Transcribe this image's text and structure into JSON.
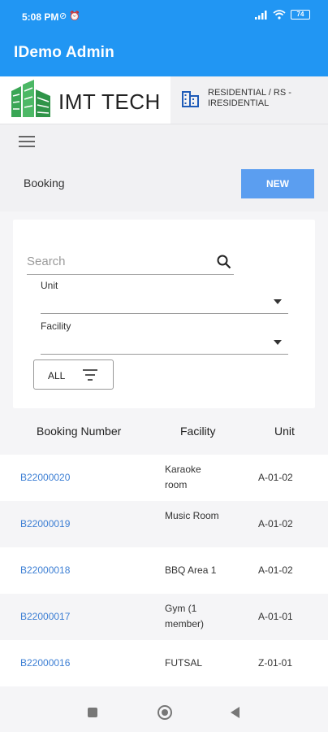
{
  "status_bar": {
    "time": "5:08 PM",
    "left_icons": "⊘ ⏰",
    "battery": "74"
  },
  "app": {
    "title": "IDemo Admin"
  },
  "brand": {
    "logo_text": "IMT TECH",
    "property": "RESIDENTIAL / RS - IRESIDENTIAL"
  },
  "page": {
    "title": "Booking",
    "new_label": "NEW"
  },
  "filters": {
    "search_placeholder": "Search",
    "search_value": "",
    "unit_label": "Unit",
    "facility_label": "Facility",
    "all_label": "ALL"
  },
  "table": {
    "headers": {
      "booking_number": "Booking Number",
      "facility": "Facility",
      "unit": "Unit"
    },
    "rows": [
      {
        "booking_number": "B22000020",
        "facility": "Karaoke room",
        "unit": "A-01-02"
      },
      {
        "booking_number": "B22000019",
        "facility": "Music Room",
        "unit": "A-01-02"
      },
      {
        "booking_number": "B22000018",
        "facility": "BBQ Area 1",
        "unit": "A-01-02"
      },
      {
        "booking_number": "B22000017",
        "facility": "Gym (1 member)",
        "unit": "A-01-01"
      },
      {
        "booking_number": "B22000016",
        "facility": "FUTSAL",
        "unit": "Z-01-01"
      }
    ]
  },
  "colors": {
    "app_bar": "#2196f3",
    "new_button": "#5b9ef0",
    "link": "#3d7fd4",
    "logo_green": "#3aa655"
  },
  "icons": {
    "menu": "hamburger-icon",
    "search": "search-icon",
    "building": "building-icon",
    "filter": "filter-icon",
    "dropdown": "caret-down-icon"
  }
}
